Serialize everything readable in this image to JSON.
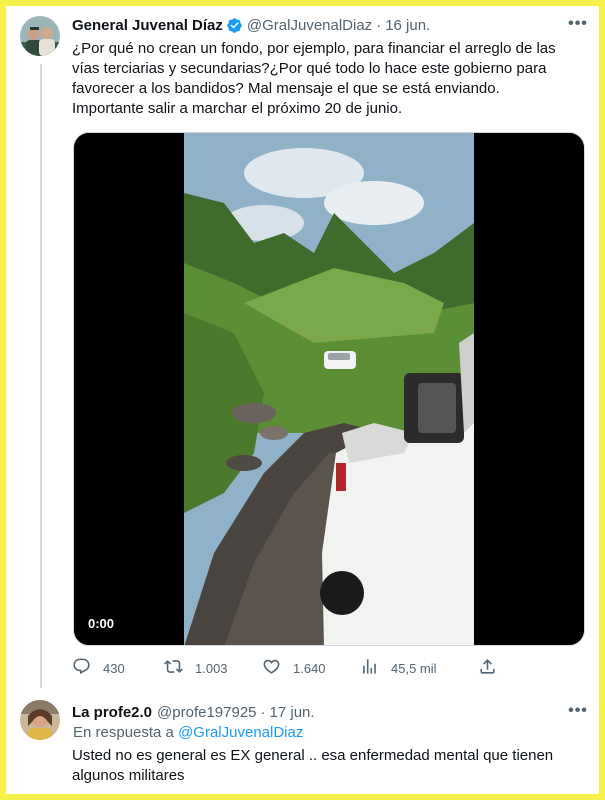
{
  "colors": {
    "accent": "#1d9bf0",
    "frame": "#f7f04a",
    "muted": "#536471"
  },
  "tweet": {
    "author_name": "General Juvenal Díaz",
    "verified_icon": "verified-badge-icon",
    "handle": "@GralJuvenalDiaz",
    "separator": "·",
    "date": "16 jun.",
    "more_icon": "more-icon",
    "more_label": "•••",
    "text_lines": [
      "¿Por qué no crean un fondo, por ejemplo, para financiar el arreglo de las",
      "vías terciarias y secundarias?¿Por qué todo lo hace este gobierno para",
      "favorecer a los bandidos? Mal mensaje el que se está enviando.",
      "Importante salir a marchar el próximo 20 de junio."
    ],
    "video": {
      "timestamp": "0:00"
    },
    "actions": {
      "replies": "430",
      "retweets": "1.003",
      "likes": "1.640",
      "views": "45,5 mil"
    }
  },
  "reply": {
    "author_name": "La profe2.0",
    "handle": "@profe197925",
    "separator": "·",
    "date": "17 jun.",
    "more_label": "•••",
    "replying_prefix": "En respuesta a",
    "replying_to": "@GralJuvenalDiaz",
    "text_lines": [
      "Usted no es general es EX general .. esa enfermedad mental que tienen",
      "algunos militares"
    ]
  }
}
